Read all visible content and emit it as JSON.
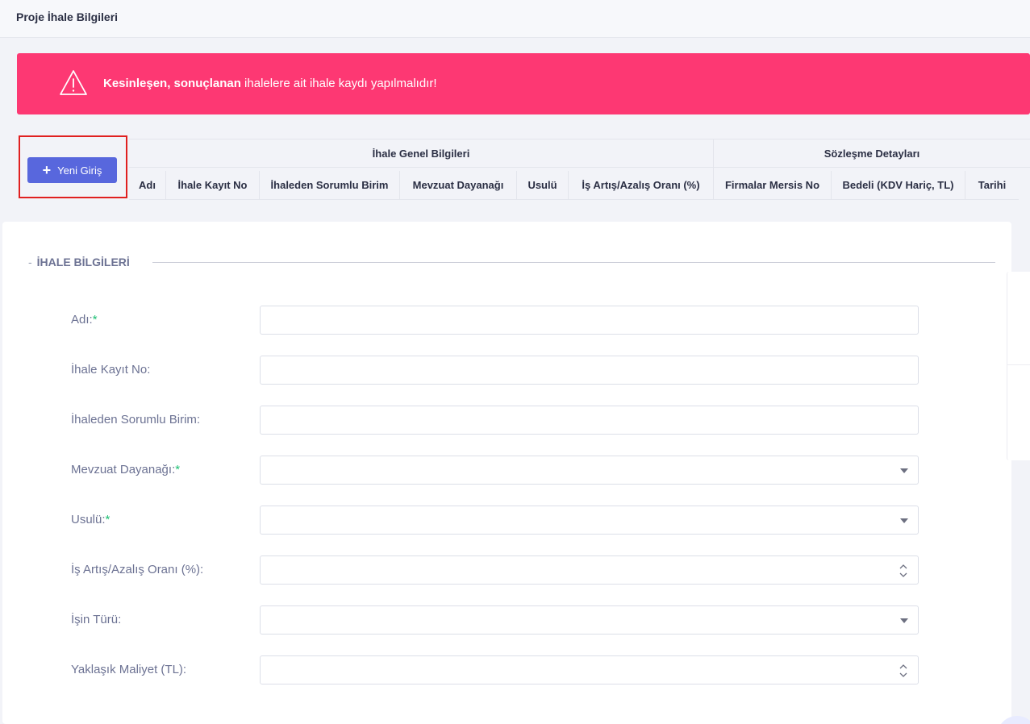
{
  "page": {
    "title": "Proje İhale Bilgileri"
  },
  "alert": {
    "icon": "warning-triangle-icon",
    "bold_text": "Kesinleşen, sonuçlanan",
    "text": " ihalelere ait ihale kaydı yapılmalıdır!",
    "color": "#fd3873"
  },
  "toolbar": {
    "new_entry_label": "Yeni Giriş",
    "new_entry_icon": "plus-icon",
    "accent": "#5867dd"
  },
  "table": {
    "groups": [
      "İhale Genel Bilgileri",
      "Sözleşme Detayları"
    ],
    "columns": [
      "Adı",
      "İhale Kayıt No",
      "İhaleden Sorumlu Birim",
      "Mevzuat Dayanağı",
      "Usulü",
      "İş Artış/Azalış Oranı (%)",
      "Firmalar Mersis No",
      "Bedeli (KDV Hariç, TL)",
      "Tarihi"
    ]
  },
  "form": {
    "section_title": "İHALE BİLGİLERİ",
    "fields": [
      {
        "label": "Adı:",
        "required": "*",
        "type": "text",
        "value": ""
      },
      {
        "label": "İhale Kayıt No:",
        "required": "",
        "type": "text",
        "value": ""
      },
      {
        "label": "İhaleden Sorumlu Birim:",
        "required": "",
        "type": "text",
        "value": ""
      },
      {
        "label": "Mevzuat Dayanağı:",
        "required": "*",
        "type": "select",
        "value": ""
      },
      {
        "label": "Usulü:",
        "required": "*",
        "type": "select",
        "value": ""
      },
      {
        "label": "İş Artış/Azalış Oranı (%):",
        "required": "",
        "type": "number",
        "value": ""
      },
      {
        "label": "İşin Türü:",
        "required": "",
        "type": "select",
        "value": ""
      },
      {
        "label": "Yaklaşık Maliyet (TL):",
        "required": "",
        "type": "number",
        "value": ""
      }
    ]
  }
}
